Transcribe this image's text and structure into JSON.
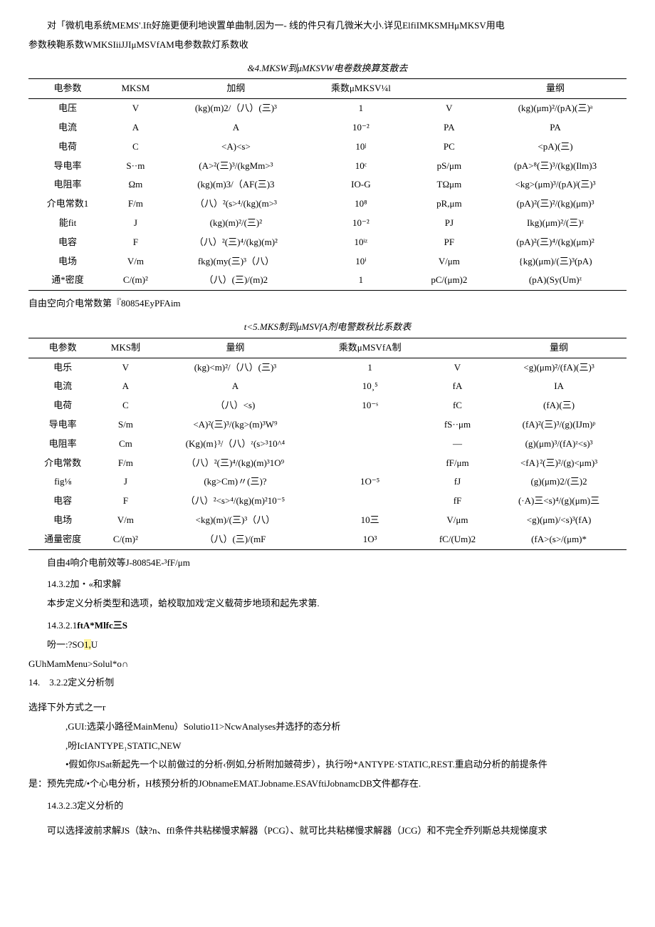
{
  "intro_line1": "对「微机电系统MEMS'.Ift好施更便利地谀置单曲制,因为一-                线的件只有几微米大小.详见ElfiIMKSMHμMKSV用电",
  "intro_line2": "参数秧鞄系数WMKSIiiJJIμMSVfAM电参数款灯系数收",
  "table1": {
    "title": "&4.MKSW到μMKSVW电卷数换算笈散去",
    "headers": [
      "电参数",
      "MKSM",
      "加纲",
      "乘数μMKSV¼l",
      "",
      "量纲"
    ],
    "rows": [
      [
        "电压",
        "V",
        "(kg)(m)2/（八）(三)³",
        "1",
        "V",
        "(kg)(μm)²/(pA)(三)ᵃ"
      ],
      [
        "电流",
        "A",
        "A",
        "10⁻²",
        "PA",
        "PA"
      ],
      [
        "电荷",
        "C",
        "<A)<s>",
        "10ʲ",
        "PC",
        "<pA)(三)"
      ],
      [
        "导电率",
        "S··m",
        "(A>²(三)³/(kgMm>³",
        "10ᶜ",
        "pS/μm",
        "(pA>⁸(三)³/(kg)(Ilm)3"
      ],
      [
        "电阻率",
        "Ωm",
        "(kg)(m)3/（AF(三)3",
        "IO-G",
        "TΩμm",
        "<kg>(μm)³/(pA)ʲ(三)³"
      ],
      [
        "介电常数1",
        "F/m",
        "（八）²(s>⁴/(kg)(m>³",
        "10⁸",
        "pR,μm",
        "(pA)²(三)²/(kg)(μm)³"
      ],
      [
        "能fit",
        "J",
        "(kg)(m)²/(三)²",
        "10⁻²",
        "PJ",
        "Ikg)(μm)²/(三)ᶻ"
      ],
      [
        "电容",
        "F",
        "（八）²(三)⁴/(kg)(m)²",
        "10ᶤᶻ",
        "PF",
        "(pA)²(三)⁴/(kg)(μm)²"
      ],
      [
        "电场",
        "V/m",
        "fkg)(my(三)³（八）",
        "10ⁱ",
        "V/μm",
        "{kg)(μm)/(三)³(pA)"
      ],
      [
        "通*密度",
        "C/(m)²",
        "（八）(三)/(m)2",
        "1",
        "pC/(μm)2",
        "(pA)(Sy(Um)ᶻ"
      ]
    ]
  },
  "note1": "自由空向介电常数第『80854EyPFAim",
  "table2": {
    "title": "t<5.MKS制到μMSVfA剂电警数秋比系数表",
    "headers": [
      "电参数",
      "MKS制",
      "量纲",
      "乘数μMSVfA制",
      "",
      "量纲"
    ],
    "rows": [
      [
        "电乐",
        "V",
        "(kg)<m)²/（八）(三)³",
        "1",
        "V",
        "<g)(μm)²/(fA)(三)³"
      ],
      [
        "电流",
        "A",
        "A",
        "10¸⁵",
        "fA",
        "IA"
      ],
      [
        "电荷",
        "C",
        "（八）<s)",
        "10⁻ˢ",
        "fC",
        "(fA)(三)"
      ],
      [
        "导电率",
        "S/m",
        "<A)²(三)³/(kg>(m)³W⁹",
        "",
        "fS··μm",
        "(fA)²(三)³/(g)(IJm)ᵖ"
      ],
      [
        "电阻率",
        "Cm",
        "(Kg)(m}³/（八）ᶻ(s>³10^⁴",
        "",
        "—",
        "(g)(μm)³/(fA)ᶻ<s)³"
      ],
      [
        "介电常数",
        "F/m",
        "（八）²(三)⁴/(kg)(m)³1O⁹",
        "",
        "fF/μm",
        "<fA}²(三)²/(g)<μm)³"
      ],
      [
        "fig⅛",
        "J",
        "(kg>Cm)〃(三)?",
        "1O⁻⁵",
        "fJ",
        "(g)(μm)2/(三)2"
      ],
      [
        "电容",
        "F",
        "（八）²<s>⁴/(kg)(m)²10⁻⁵",
        "",
        "fF",
        "(·A)三<s)⁴/(g)(μm)三"
      ],
      [
        "电场",
        "V/m",
        "<kg)(m)/(三)³（八）",
        "10三",
        "V/μm",
        "<g)(μm)/<s)³(fA)"
      ],
      [
        "通量密度",
        "C/(m)²",
        "（八）(三)/(mF",
        "1O³",
        "fC/(Um)2",
        "(fA>(s>/(μm)*"
      ]
    ]
  },
  "note2": "自由4响介电前效等J-80854E-³fF/μm",
  "sec_1432": "14.3.2加・«和求解",
  "sec_1432_body": "本步定义分析类型和选项，蛤校取加戏'定义载荷步地顼和起先求第.",
  "sec_14321_num": "14.3.2.1",
  "sec_14321_title": "ftA*Mlfc三S",
  "line_so1": "吩一:?SO",
  "line_so1_hl": "1,",
  "line_so1_after": "U",
  "line_gui1": "GUhMamMenu>Solul*o∩",
  "sec_14322": "14.　3.2.2定义分析刎",
  "line_choose": "选择下外方式之一r",
  "bullet1": ",GUI:选菜小路径MainMenu）Solutio11>NcwAnalyses并选抒的态分析",
  "bullet2": ",吩IcIANTYPE₁STATIC,NEW",
  "bullet3_1": "•假如你JSat新起先一个以前做过的分析‹例如,分析附加皴荷步），执行吩*ANTYPE·STATIC,REST.重启动分析的前提条件",
  "bullet3_2": "是：预先完成/•个心电分析，H核预分析的JObnameEMAT.Jobname.ESAVftiJobnamcDB文件都存在.",
  "sec_14323": "14.3.2.3定义分析的",
  "final_para": "可以选择波前求解JS（缺?n、ffl条件共粘梯慢求解器（PCG）、就可比共粘梯慢求解器（JCG）和不完全乔列斯总共规悌度求"
}
